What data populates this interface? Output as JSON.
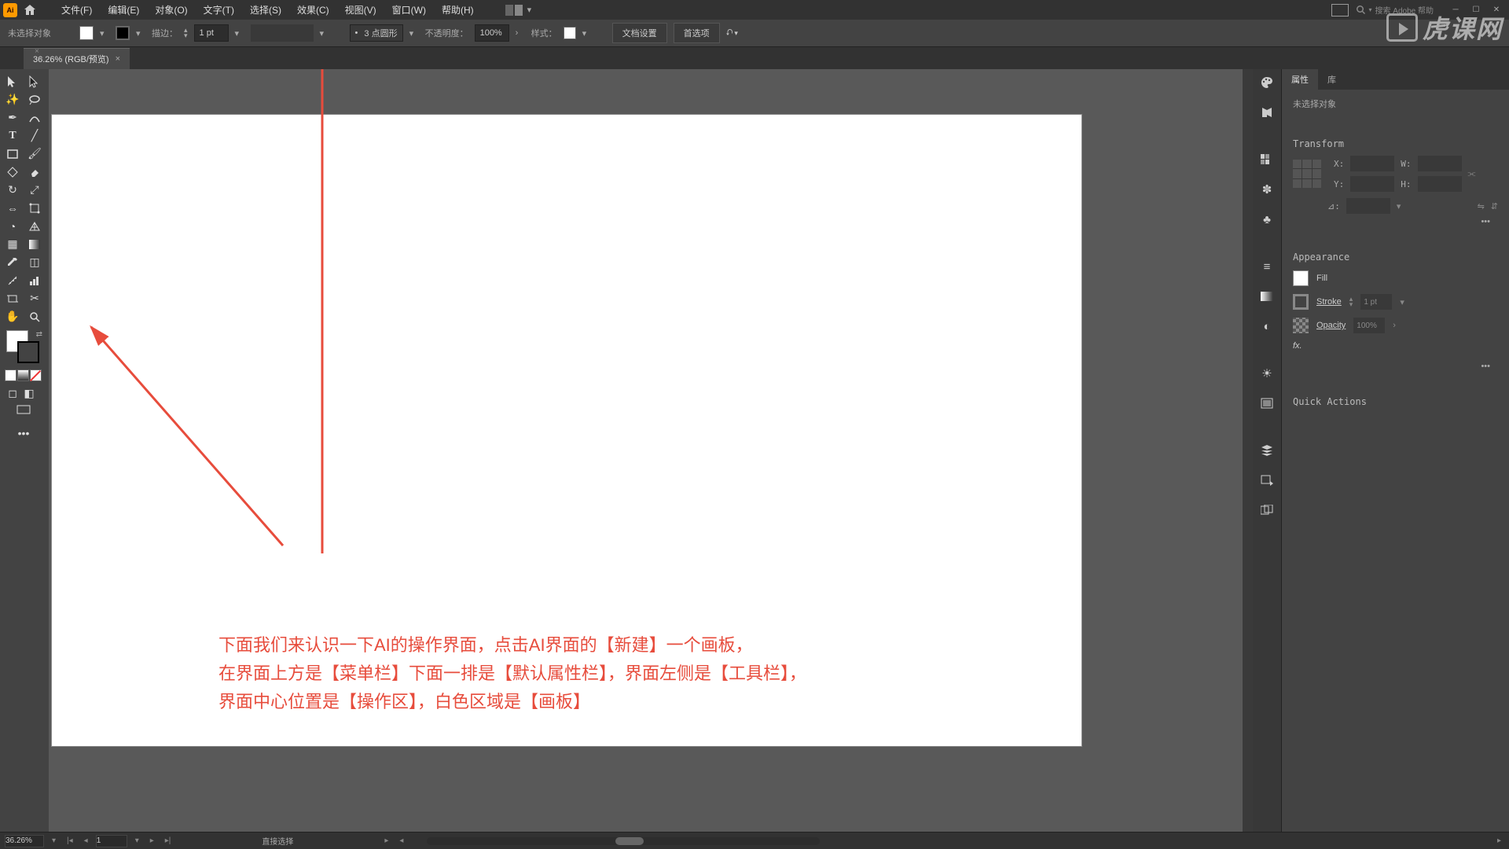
{
  "menu": {
    "file": "文件(F)",
    "edit": "编辑(E)",
    "object": "对象(O)",
    "type": "文字(T)",
    "select": "选择(S)",
    "effect": "效果(C)",
    "view": "视图(V)",
    "window": "窗口(W)",
    "help": "帮助(H)"
  },
  "search_placeholder": "搜索 Adobe 帮助",
  "control": {
    "no_selection": "未选择对象",
    "stroke_label": "描边：",
    "stroke_val": "1 pt",
    "dash_label": "3 点圆形",
    "opacity_label": "不透明度：",
    "opacity_val": "100%",
    "style_label": "样式：",
    "doc_setup": "文档设置",
    "prefs": "首选项"
  },
  "tab": {
    "title": "36.26% (RGB/预览)"
  },
  "props": {
    "tab_props": "属性",
    "tab_lib": "库",
    "no_sel": "未选择对象",
    "transform": "Transform",
    "x_label": "X:",
    "y_label": "Y:",
    "w_label": "W:",
    "h_label": "H:",
    "angle_label": "⊿:",
    "x_val": "",
    "y_val": "",
    "w_val": "",
    "h_val": "",
    "appearance": "Appearance",
    "fill": "Fill",
    "stroke": "Stroke",
    "stroke_val": "1 pt",
    "opacity": "Opacity",
    "opacity_val": "100%",
    "fx": "fx.",
    "quick": "Quick Actions"
  },
  "status": {
    "zoom": "36.26%",
    "artboard": "1",
    "tool_hint": "直接选择"
  },
  "annotation": {
    "line1": "下面我们来认识一下AI的操作界面，点击AI界面的【新建】一个画板，",
    "line2": "在界面上方是【菜单栏】下面一排是【默认属性栏】，界面左侧是【工具栏】，",
    "line3": "界面中心位置是【操作区】，白色区域是【画板】"
  },
  "watermark_text": "虎课网"
}
